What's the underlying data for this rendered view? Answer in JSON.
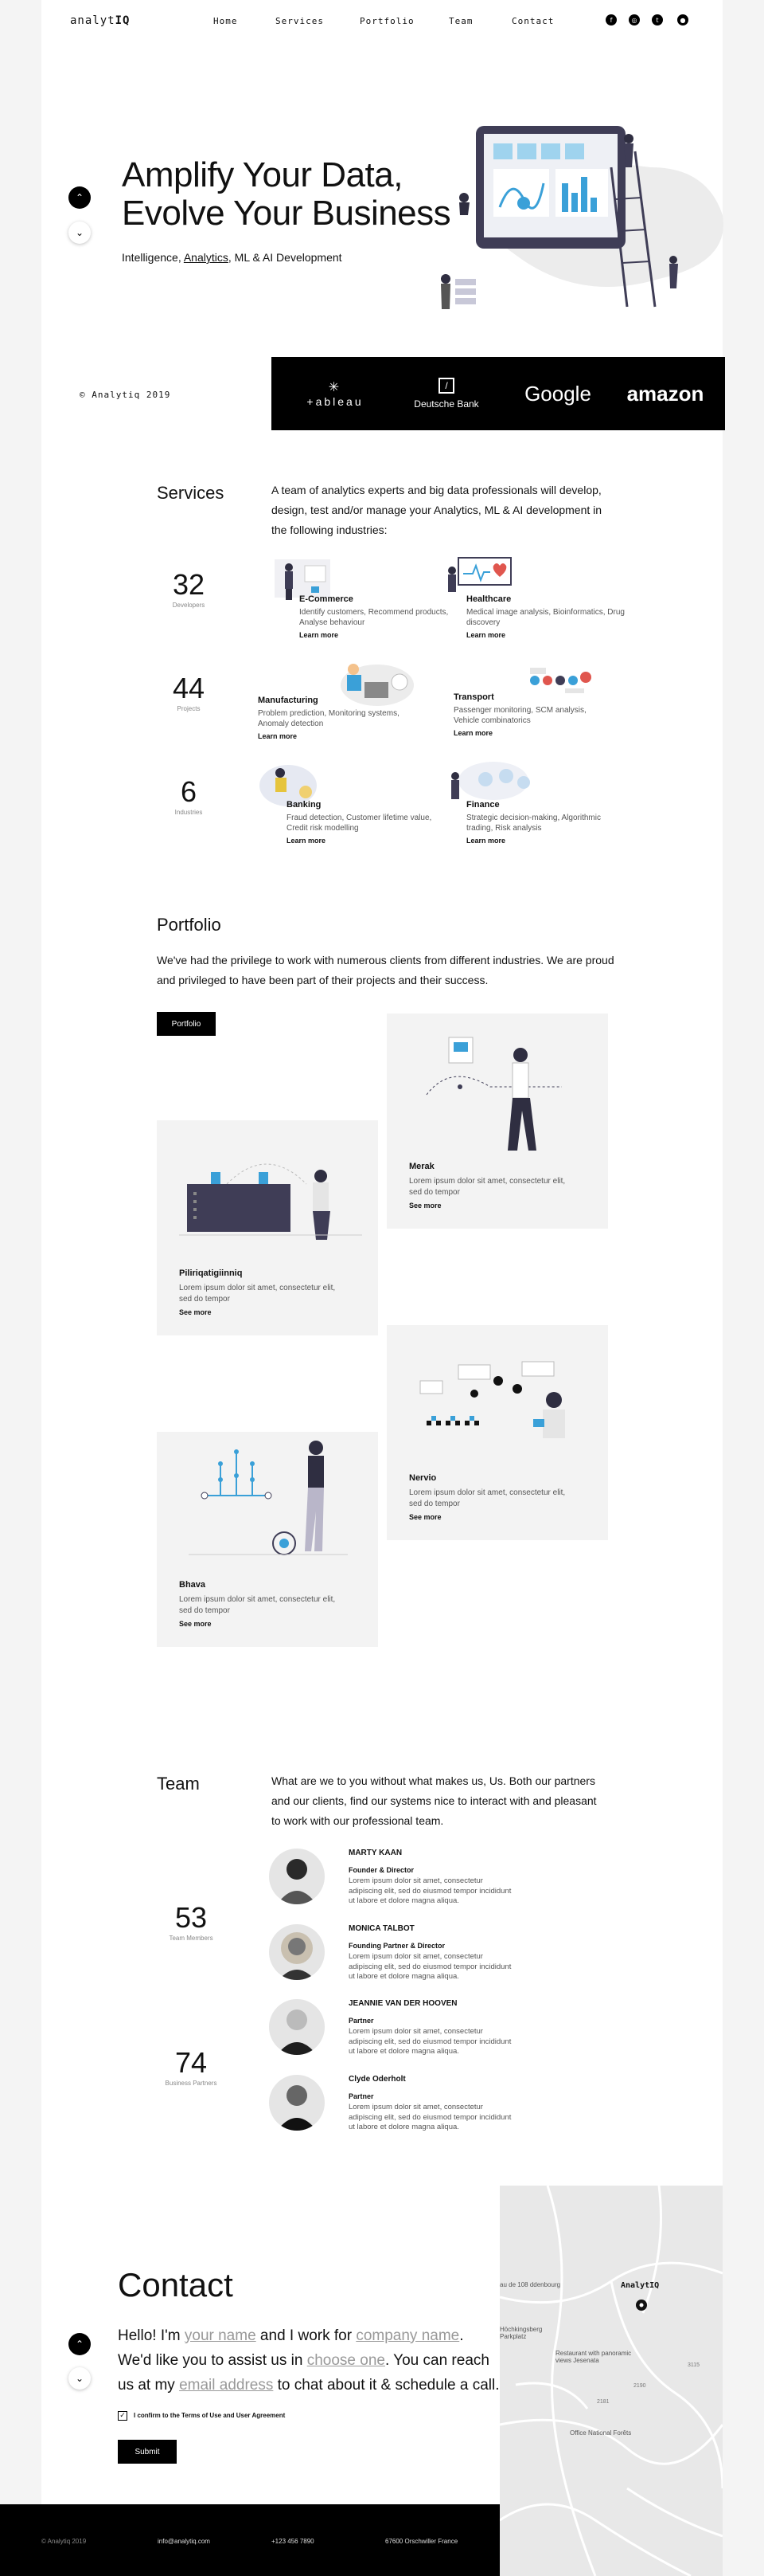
{
  "header": {
    "logo_prefix": "analyt",
    "logo_suffix": "IQ",
    "nav": [
      "Home",
      "Services",
      "Portfolio",
      "Team",
      "Contact"
    ],
    "social_icons": [
      "facebook-icon",
      "instagram-icon",
      "twitter-icon",
      "github-icon"
    ]
  },
  "hero": {
    "title_line1": "Amplify Your Data,",
    "title_line2": "Evolve Your Business",
    "sub_before": "Intelligence, ",
    "sub_link": "Analytics",
    "sub_after": ", ML & AI Development"
  },
  "brands_bar": {
    "copyright": "© Analytiq 2019",
    "brands": [
      "+ableau",
      "Deutsche Bank",
      "Google",
      "amazon"
    ]
  },
  "services": {
    "title": "Services",
    "intro": "A team of analytics experts and big data professionals will develop, design, test and/or manage your Analytics, ML & AI development in the following industries:",
    "stats": [
      {
        "num": "32",
        "label": "Developers"
      },
      {
        "num": "44",
        "label": "Projects"
      },
      {
        "num": "6",
        "label": "Industries"
      }
    ],
    "items": [
      {
        "title": "E-Commerce",
        "desc": "Identify customers, Recommend products, Analyse behaviour",
        "more": "Learn more"
      },
      {
        "title": "Healthcare",
        "desc": "Medical image analysis, Bioinformatics, Drug discovery",
        "more": "Learn more"
      },
      {
        "title": "Manufacturing",
        "desc": "Problem prediction, Monitoring systems, Anomaly detection",
        "more": "Learn more"
      },
      {
        "title": "Transport",
        "desc": "Passenger monitoring, SCM analysis, Vehicle combinatorics",
        "more": "Learn more"
      },
      {
        "title": "Banking",
        "desc": "Fraud detection, Customer lifetime value, Credit risk modelling",
        "more": "Learn more"
      },
      {
        "title": "Finance",
        "desc": "Strategic decision-making, Algorithmic trading, Risk analysis",
        "more": "Learn more"
      }
    ]
  },
  "portfolio": {
    "title": "Portfolio",
    "intro": "We've had the privilege to work with numerous clients from different industries. We are proud and privileged to have been part of their projects and their success.",
    "button": "Portfolio",
    "cards": [
      {
        "title": "Merak",
        "desc": "Lorem ipsum dolor sit amet, consectetur elit, sed do tempor",
        "more": "See more"
      },
      {
        "title": "Piliriqatigiinniq",
        "desc": "Lorem ipsum dolor sit amet, consectetur elit, sed do tempor",
        "more": "See more"
      },
      {
        "title": "Nervio",
        "desc": "Lorem ipsum dolor sit amet, consectetur elit, sed do tempor",
        "more": "See more"
      },
      {
        "title": "Bhava",
        "desc": "Lorem ipsum dolor sit amet, consectetur elit, sed do tempor",
        "more": "See more"
      }
    ]
  },
  "team": {
    "title": "Team",
    "intro": "What are we to you without what makes us, Us.  Both our partners and our clients, find our systems nice to  interact with and pleasant to work with our professional team.",
    "stats": [
      {
        "num": "53",
        "label": "Team Members"
      },
      {
        "num": "74",
        "label": "Business Partners"
      }
    ],
    "members": [
      {
        "name": "MARTY KAAN",
        "role": "Founder & Director",
        "bio": "Lorem ipsum dolor sit amet, consectetur adipiscing elit, sed do eiusmod tempor incididunt ut labore et dolore magna aliqua."
      },
      {
        "name": "MONICA TALBOT",
        "role": "Founding Partner & Director",
        "bio": "Lorem ipsum dolor sit amet, consectetur adipiscing elit, sed do eiusmod tempor incididunt ut labore et dolore magna aliqua."
      },
      {
        "name": "JEANNIE VAN DER HOOVEN",
        "role": "Partner",
        "bio": "Lorem ipsum dolor sit amet, consectetur adipiscing elit, sed do eiusmod tempor incididunt ut labore et dolore magna aliqua."
      },
      {
        "name": "Clyde Oderholt",
        "role": "Partner",
        "bio": "Lorem ipsum dolor sit amet, consectetur adipiscing elit, sed do eiusmod tempor incididunt ut labore et dolore magna aliqua."
      }
    ]
  },
  "contact": {
    "title": "Contact",
    "p1": "Hello! I'm ",
    "name_placeholder": "your name",
    "p2": " and I work for ",
    "company_placeholder": "company name",
    "p3": ". We'd like you to assist us in ",
    "choice_placeholder": "choose one",
    "p4": ". You can reach us at my ",
    "email_placeholder": "email address",
    "p5": " to chat about it & schedule a call.",
    "agree": "I confirm to the Terms of Use and User Agreement",
    "submit": "Submit"
  },
  "map": {
    "marker_label": "AnalytIQ",
    "labels": [
      "au de 108 ddenbourg",
      "Höchkingsberg Parkplatz",
      "Restaurant with panoramic views Jesenata",
      "Office National Forêts",
      "2190",
      "2181",
      "3115"
    ]
  },
  "footer": {
    "copyright": "© Analytiq 2019",
    "email": "info@analytiq.com",
    "phone": "+123 456 7890",
    "address": "67600 Orschwiller France"
  },
  "colors": {
    "accent_blue": "#3aa0d8",
    "black": "#000000",
    "card_bg": "#f3f3f3"
  }
}
